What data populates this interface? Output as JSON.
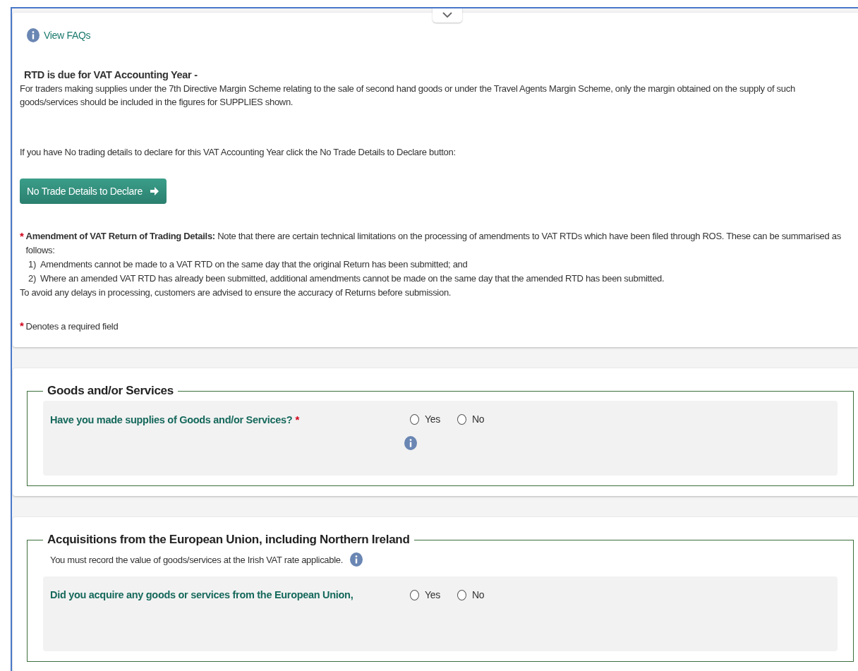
{
  "faq_link": {
    "label": "View FAQs"
  },
  "intro": {
    "heading": "RTD is due for VAT Accounting Year -",
    "paragraph": "For traders making supplies under the 7th Directive Margin Scheme relating to the sale of second hand goods or under the Travel Agents Margin Scheme, only the margin obtained on the supply of such goods/services should be included in the figures for SUPPLIES shown.",
    "no_trade_prompt": "If you have No trading details to declare for this VAT Accounting Year click the No Trade Details to Declare button:",
    "no_trade_button": "No Trade Details to Declare"
  },
  "amendment_notice": {
    "required_mark": "*",
    "text": "**Amendment of VAT Return of Trading Details:** Note that there are certain technical limitations on the processing of amendments to VAT RTDs which have been filed through ROS. These can be summarised as follows:",
    "points": [
      {
        "number": "1)",
        "text": "Amendments cannot be made to a VAT RTD on the same day that the original Return has been submitted; and"
      },
      {
        "number": "2)",
        "text": "Where an amended VAT RTD has already been submitted, additional amendments cannot be made on the same day that the amended RTD has been submitted."
      }
    ],
    "closing": "To avoid any delays in processing, customers are advised to ensure the accuracy of Returns before submission."
  },
  "required_note": {
    "mark": "*",
    "text": "Denotes a required field"
  },
  "sections": [
    {
      "legend": "Goods and/or Services",
      "questions": [
        {
          "text": "Have you made supplies of Goods and/or Services?",
          "required_mark": "*",
          "info_icon": true,
          "options": [
            {
              "label": "Yes",
              "selected": false
            },
            {
              "label": "No",
              "selected": false
            }
          ]
        }
      ]
    },
    {
      "legend": "Acquisitions from the European Union, including Northern Ireland",
      "note": "You must record the value of goods/services at the Irish VAT rate applicable.",
      "note_info_icon": true,
      "questions": [
        {
          "text": "Did you acquire any goods or services from the European Union,",
          "info_icon": false,
          "options": [
            {
              "label": "Yes",
              "selected": false
            },
            {
              "label": "No",
              "selected": false
            }
          ]
        }
      ]
    }
  ]
}
